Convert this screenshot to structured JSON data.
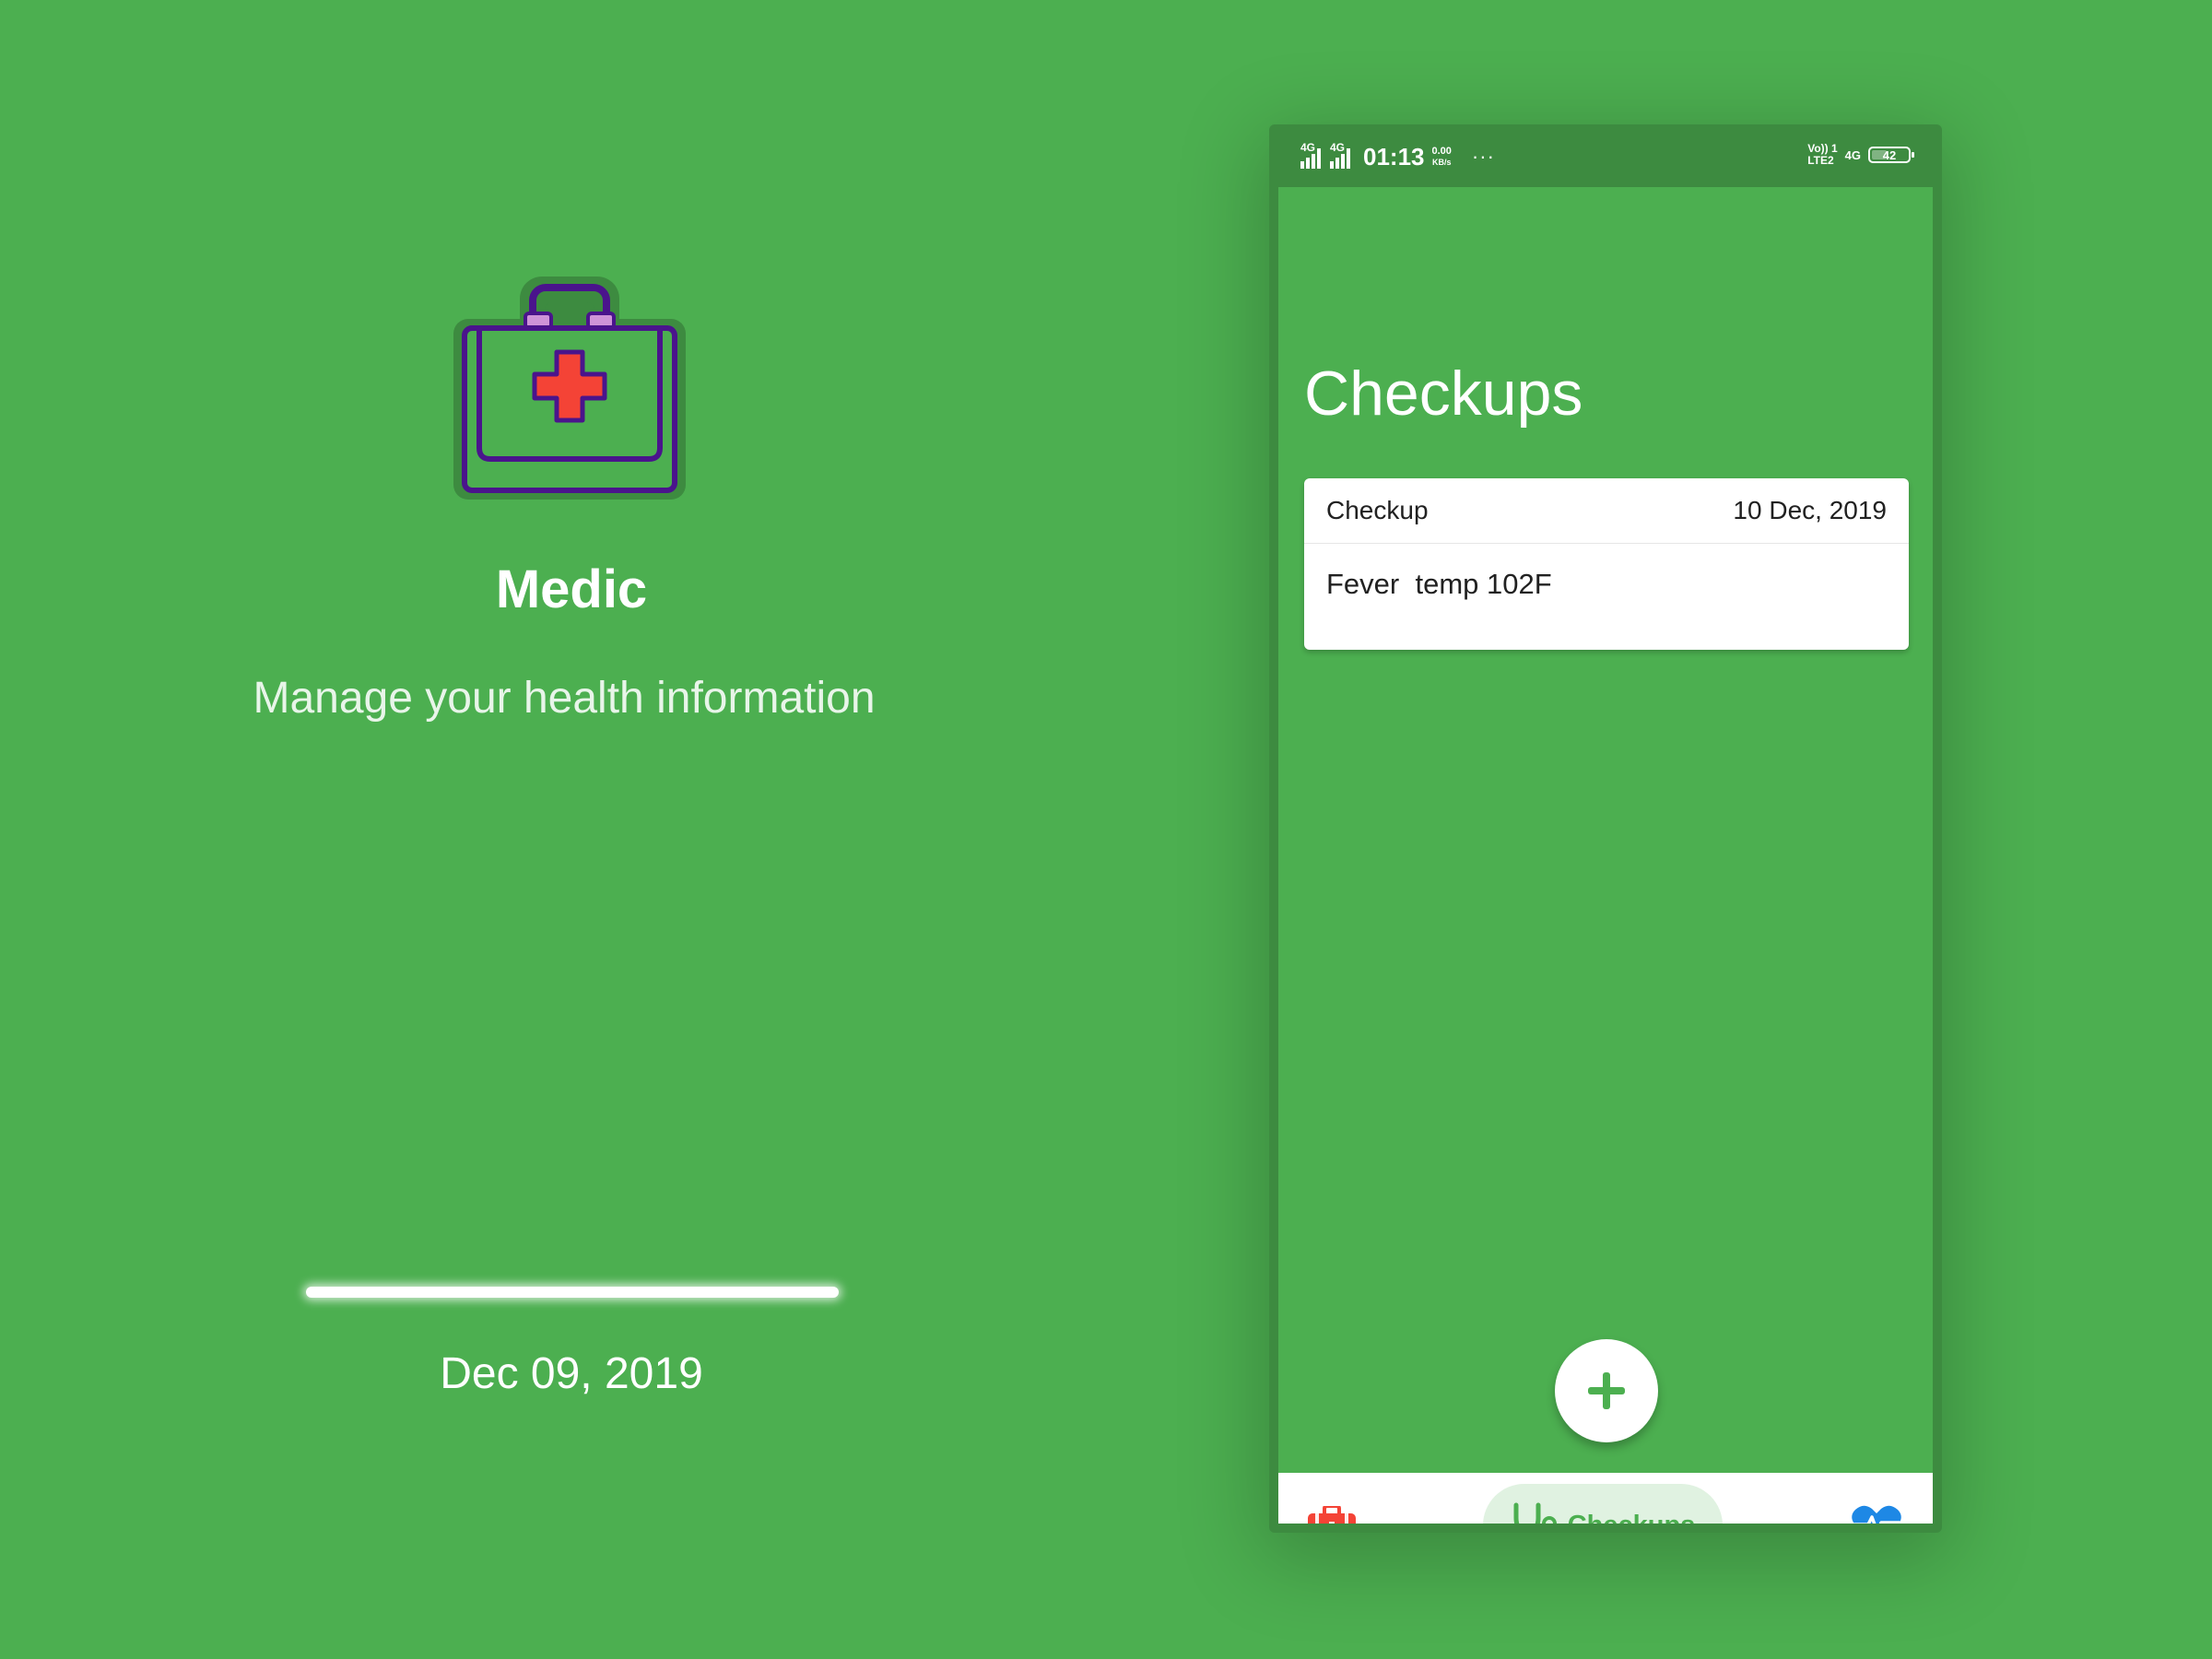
{
  "promo": {
    "logo": "medical-kit-icon",
    "title": "Medic",
    "subtitle": "Manage your health information",
    "date": "Dec 09, 2019"
  },
  "status_bar": {
    "network_1": "4G",
    "network_2": "4G",
    "time": "01:13",
    "speed_value": "0.00",
    "speed_unit": "KB/s",
    "overflow": "···",
    "volte_line1": "Vo)) 1",
    "volte_line2": "LTE2",
    "network_right": "4G",
    "battery_level": "42"
  },
  "screen": {
    "title": "Checkups",
    "checkups": [
      {
        "type": "Checkup",
        "date": "10 Dec, 2019",
        "note": "Fever  temp 102F"
      }
    ]
  },
  "bottom_nav": {
    "items": [
      {
        "icon": "medical-kit-icon",
        "label": "",
        "active": false
      },
      {
        "icon": "stethoscope-icon",
        "label": "Checkups",
        "active": true
      },
      {
        "icon": "heart-pulse-icon",
        "label": "",
        "active": false
      }
    ]
  },
  "system_nav": [
    "menu-icon",
    "home-icon",
    "back-icon"
  ],
  "colors": {
    "background": "#4caf50",
    "status_bar": "#3d8b40",
    "active_pill": "#e0f2e1",
    "accent_green": "#4caf50",
    "kit_red": "#f44336",
    "heart_blue": "#1e88e5"
  }
}
